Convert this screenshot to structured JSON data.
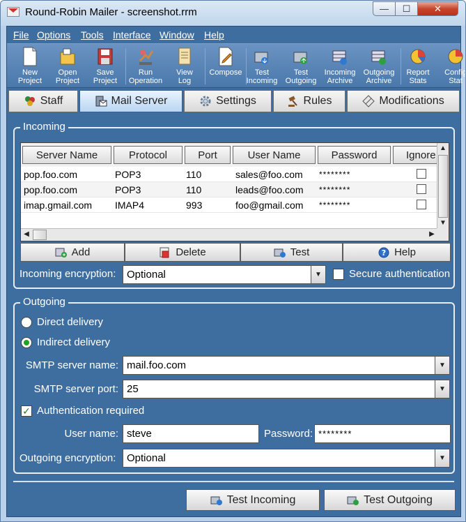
{
  "window": {
    "title": "Round-Robin Mailer - screenshot.rrm",
    "minimize": "—",
    "maximize": "☐",
    "close": "✕"
  },
  "menu": [
    "File",
    "Options",
    "Tools",
    "Interface",
    "Window",
    "Help"
  ],
  "toolbar": [
    {
      "line1": "New",
      "line2": "Project",
      "icon": "new-project-icon"
    },
    {
      "line1": "Open",
      "line2": "Project",
      "icon": "open-project-icon"
    },
    {
      "line1": "Save",
      "line2": "Project",
      "icon": "save-project-icon"
    },
    {
      "line1": "Run",
      "line2": "Operation",
      "icon": "run-operation-icon"
    },
    {
      "line1": "View",
      "line2": "Log",
      "icon": "view-log-icon"
    },
    {
      "line1": "Compose",
      "line2": "",
      "icon": "compose-icon"
    },
    {
      "line1": "Test",
      "line2": "Incoming",
      "icon": "test-incoming-icon"
    },
    {
      "line1": "Test",
      "line2": "Outgoing",
      "icon": "test-outgoing-icon"
    },
    {
      "line1": "Incoming",
      "line2": "Archive",
      "icon": "incoming-archive-icon"
    },
    {
      "line1": "Outgoing",
      "line2": "Archive",
      "icon": "outgoing-archive-icon"
    },
    {
      "line1": "Report",
      "line2": "Stats",
      "icon": "report-stats-icon"
    },
    {
      "line1": "Config",
      "line2": "Stat",
      "icon": "config-stats-icon"
    }
  ],
  "tabs": [
    {
      "label": "Staff",
      "icon": "staff-icon"
    },
    {
      "label": "Mail Server",
      "icon": "mail-server-icon",
      "active": true
    },
    {
      "label": "Settings",
      "icon": "settings-gear-icon"
    },
    {
      "label": "Rules",
      "icon": "rules-gavel-icon"
    },
    {
      "label": "Modifications",
      "icon": "modifications-icon"
    }
  ],
  "incoming": {
    "title": "Incoming",
    "columns": [
      "Server Name",
      "Protocol",
      "Port",
      "User Name",
      "Password",
      "Ignore"
    ],
    "rows": [
      {
        "server": "pop.foo.com",
        "protocol": "POP3",
        "port": "110",
        "user": "sales@foo.com",
        "password": "********",
        "ignore": false
      },
      {
        "server": "pop.foo.com",
        "protocol": "POP3",
        "port": "110",
        "user": "leads@foo.com",
        "password": "********",
        "ignore": false
      },
      {
        "server": "imap.gmail.com",
        "protocol": "IMAP4",
        "port": "993",
        "user": "foo@gmail.com",
        "password": "********",
        "ignore": false
      }
    ],
    "buttons": {
      "add": "Add",
      "delete": "Delete",
      "test": "Test",
      "help": "Help"
    },
    "encryption_label": "Incoming encryption:",
    "encryption_value": "Optional",
    "secure_auth_label": "Secure authentication",
    "secure_auth_checked": false
  },
  "outgoing": {
    "title": "Outgoing",
    "direct_label": "Direct delivery",
    "indirect_label": "Indirect delivery",
    "selected": "indirect",
    "smtp_name_label": "SMTP server name:",
    "smtp_name_value": "mail.foo.com",
    "smtp_port_label": "SMTP server port:",
    "smtp_port_value": "25",
    "auth_label": "Authentication required",
    "auth_checked": true,
    "username_label": "User name:",
    "username_value": "steve",
    "password_label": "Password:",
    "password_value": "********",
    "encryption_label": "Outgoing encryption:",
    "encryption_value": "Optional"
  },
  "bottom": {
    "test_incoming": "Test Incoming",
    "test_outgoing": "Test Outgoing"
  },
  "colors": {
    "frame": "#3e6ea0",
    "titlebar": "#c0d6ec",
    "close": "#c7462a"
  }
}
